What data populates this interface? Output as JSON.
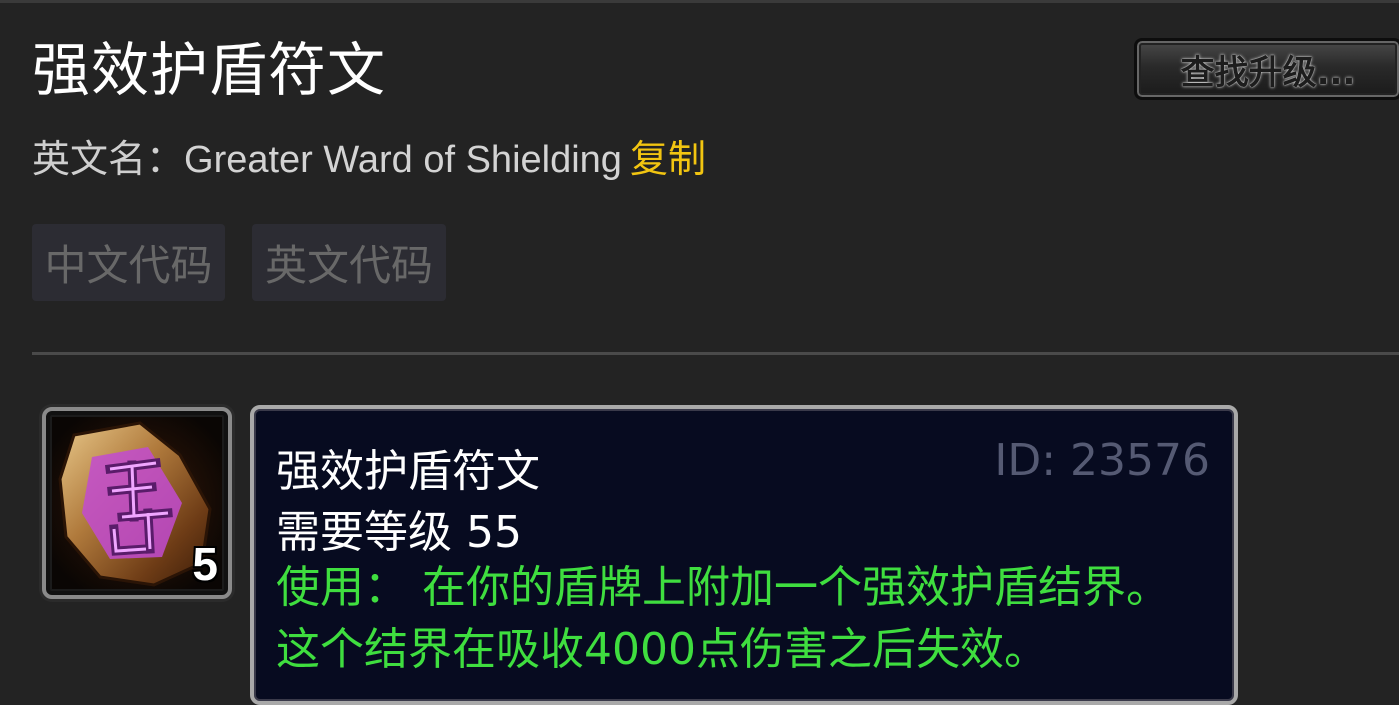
{
  "page": {
    "title": "强效护盾符文",
    "find_upgrade_label": "查找升级..."
  },
  "english_name": {
    "label": "英文名：",
    "value": "Greater Ward of Shielding",
    "copy_label": "复制"
  },
  "code_buttons": {
    "chinese": "中文代码",
    "english": "英文代码"
  },
  "item": {
    "icon": "rune-stone-icon",
    "stack_count": "5",
    "tooltip": {
      "name": "强效护盾符文",
      "id_text": "ID: 23576",
      "required_level": "需要等级 55",
      "use_text": "使用：  在你的盾牌上附加一个强效护盾结界。这个结界在吸收4000点伤害之后失效。"
    }
  },
  "colors": {
    "background": "#232323",
    "copy_link": "#f2c511",
    "use_effect": "#3fde3f",
    "item_id": "#555a73",
    "tooltip_bg": "#070b20"
  }
}
